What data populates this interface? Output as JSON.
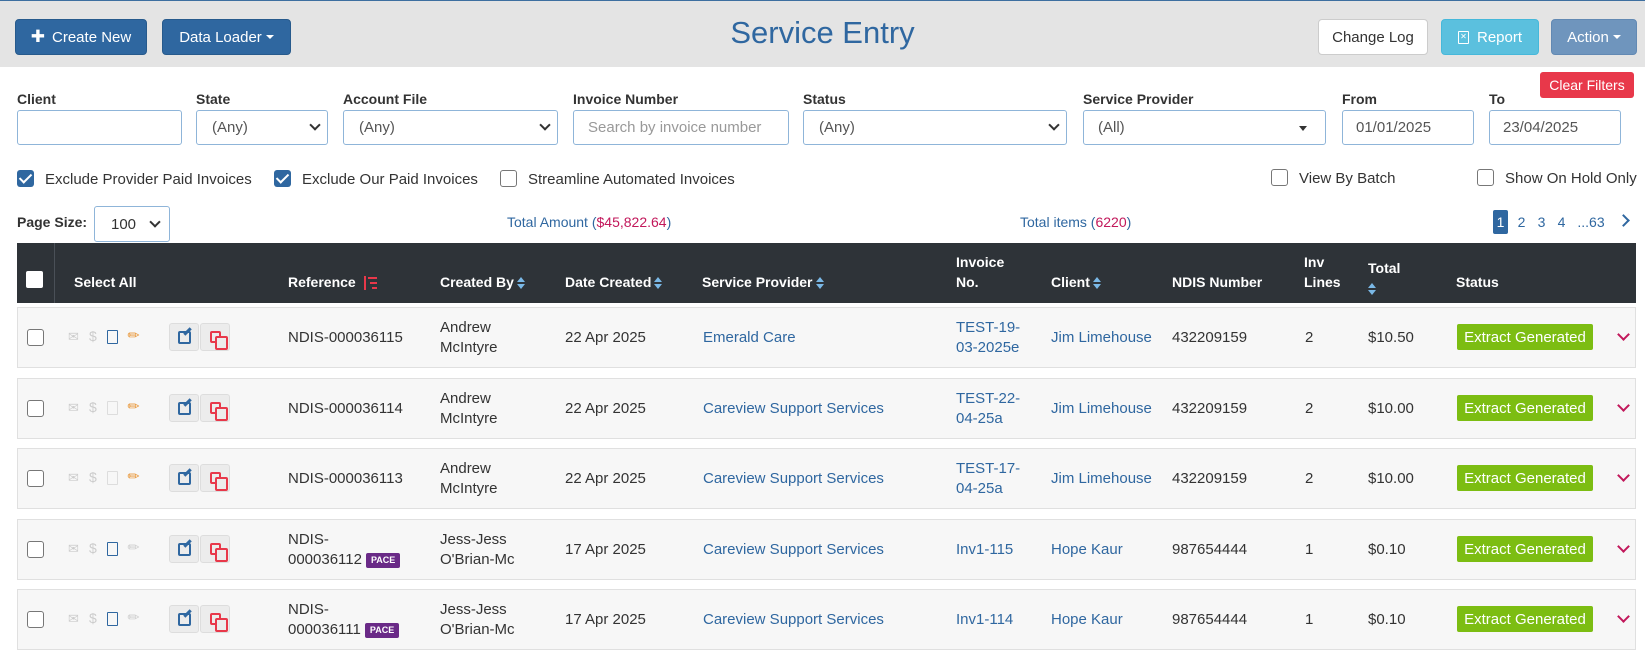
{
  "header": {
    "title": "Service Entry",
    "create_new": "Create New",
    "data_loader": "Data Loader",
    "change_log": "Change Log",
    "report": "Report",
    "action": "Action"
  },
  "filters": {
    "clear_filters": "Clear Filters",
    "client_label": "Client",
    "client_value": "",
    "state_label": "State",
    "state_value": "(Any)",
    "account_file_label": "Account File",
    "account_file_value": "(Any)",
    "invoice_number_label": "Invoice Number",
    "invoice_number_placeholder": "Search by invoice number",
    "status_label": "Status",
    "status_value": "(Any)",
    "service_provider_label": "Service Provider",
    "service_provider_value": "(All)",
    "from_label": "From",
    "from_value": "01/01/2025",
    "to_label": "To",
    "to_value": "23/04/2025"
  },
  "options": {
    "exclude_provider_paid": {
      "label": "Exclude Provider Paid Invoices",
      "checked": true
    },
    "exclude_our_paid": {
      "label": "Exclude Our Paid Invoices",
      "checked": true
    },
    "streamline_automated": {
      "label": "Streamline Automated Invoices",
      "checked": false
    },
    "view_by_batch": {
      "label": "View By Batch",
      "checked": false
    },
    "show_on_hold_only": {
      "label": "Show On Hold Only",
      "checked": false
    }
  },
  "summary": {
    "page_size_label": "Page Size:",
    "page_size_value": "100",
    "total_amount_label": "Total Amount (",
    "total_amount_value": "$45,822.64",
    "total_items_label": "Total items (",
    "total_items_value": "6220",
    "close_paren": ")"
  },
  "pagination": {
    "pages": [
      "1",
      "2",
      "3",
      "4",
      "...63"
    ],
    "current": "1"
  },
  "table": {
    "headers": {
      "select_all": "Select All",
      "reference": "Reference",
      "created_by": "Created By",
      "date_created": "Date Created",
      "service_provider": "Service Provider",
      "invoice_no_1": "Invoice",
      "invoice_no_2": "No.",
      "client": "Client",
      "ndis_number": "NDIS Number",
      "inv_lines_1": "Inv",
      "inv_lines_2": "Lines",
      "total": "Total",
      "status": "Status"
    },
    "rows": [
      {
        "ref1": "NDIS-000036115",
        "ref2": "",
        "pace": false,
        "created1": "Andrew",
        "created2": "McIntyre",
        "date": "22 Apr 2025",
        "provider": "Emerald Care",
        "inv1": "TEST-19-",
        "inv2": "03-2025e",
        "client": "Jim Limehouse",
        "ndis": "432209159",
        "lines": "2",
        "total": "$10.50",
        "status": "Extract Generated"
      },
      {
        "ref1": "NDIS-000036114",
        "ref2": "",
        "pace": false,
        "created1": "Andrew",
        "created2": "McIntyre",
        "date": "22 Apr 2025",
        "provider": "Careview Support Services",
        "inv1": "TEST-22-",
        "inv2": "04-25a",
        "client": "Jim Limehouse",
        "ndis": "432209159",
        "lines": "2",
        "total": "$10.00",
        "status": "Extract Generated"
      },
      {
        "ref1": "NDIS-000036113",
        "ref2": "",
        "pace": false,
        "created1": "Andrew",
        "created2": "McIntyre",
        "date": "22 Apr 2025",
        "provider": "Careview Support Services",
        "inv1": "TEST-17-",
        "inv2": "04-25a",
        "client": "Jim Limehouse",
        "ndis": "432209159",
        "lines": "2",
        "total": "$10.00",
        "status": "Extract Generated"
      },
      {
        "ref1": "NDIS-",
        "ref2": "000036112",
        "pace": true,
        "pace_label": "PACE",
        "created1": "Jess-Jess",
        "created2": "O'Brian-Mc",
        "date": "17 Apr 2025",
        "provider": "Careview Support Services",
        "inv1": "Inv1-115",
        "inv2": "",
        "client": "Hope Kaur",
        "ndis": "987654444",
        "lines": "1",
        "total": "$0.10",
        "status": "Extract Generated"
      },
      {
        "ref1": "NDIS-",
        "ref2": "000036111",
        "pace": true,
        "pace_label": "PACE",
        "created1": "Jess-Jess",
        "created2": "O'Brian-Mc",
        "date": "17 Apr 2025",
        "provider": "Careview Support Services",
        "inv1": "Inv1-114",
        "inv2": "",
        "client": "Hope Kaur",
        "ndis": "987654444",
        "lines": "1",
        "total": "$0.10",
        "status": "Extract Generated"
      }
    ]
  }
}
